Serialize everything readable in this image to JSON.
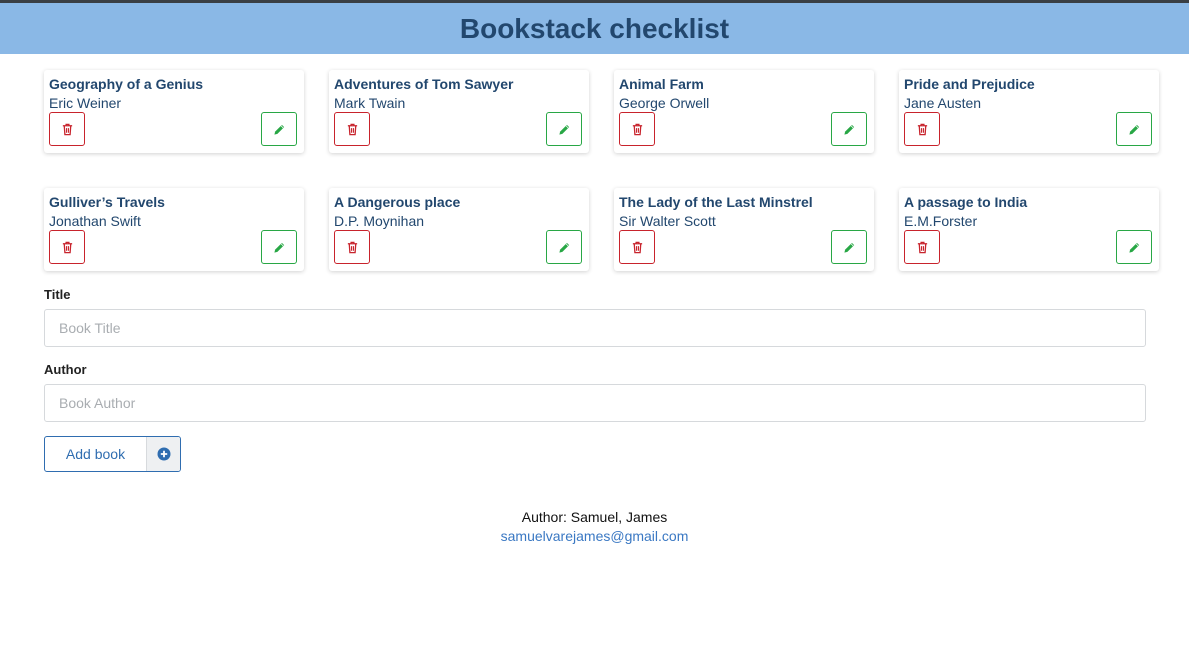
{
  "header": {
    "title": "Bookstack checklist"
  },
  "books": [
    {
      "title": "Geography of a Genius",
      "author": "Eric Weiner"
    },
    {
      "title": "Adventures of Tom Sawyer",
      "author": "Mark Twain"
    },
    {
      "title": "Animal Farm",
      "author": "George Orwell"
    },
    {
      "title": "Pride and Prejudice",
      "author": "Jane Austen"
    },
    {
      "title": "Gulliver’s Travels",
      "author": "Jonathan Swift"
    },
    {
      "title": "A Dangerous place",
      "author": "D.P. Moynihan"
    },
    {
      "title": "The Lady of the Last Minstrel",
      "author": "Sir Walter Scott"
    },
    {
      "title": "A passage to India",
      "author": "E.M.Forster"
    }
  ],
  "form": {
    "title_label": "Title",
    "title_placeholder": "Book Title",
    "author_label": "Author",
    "author_placeholder": "Book Author",
    "add_label": "Add book",
    "add_icon": "plus-circle-icon"
  },
  "footer": {
    "credit": "Author: Samuel, James",
    "email": "samuelvarejames@gmail.com"
  },
  "colors": {
    "header_bg": "#8ab8e6",
    "title_text": "#22476e",
    "delete": "#c8232c",
    "edit": "#28a745",
    "primary": "#2f6db0"
  },
  "icons": {
    "delete": "trash-icon",
    "edit": "pencil-icon"
  }
}
